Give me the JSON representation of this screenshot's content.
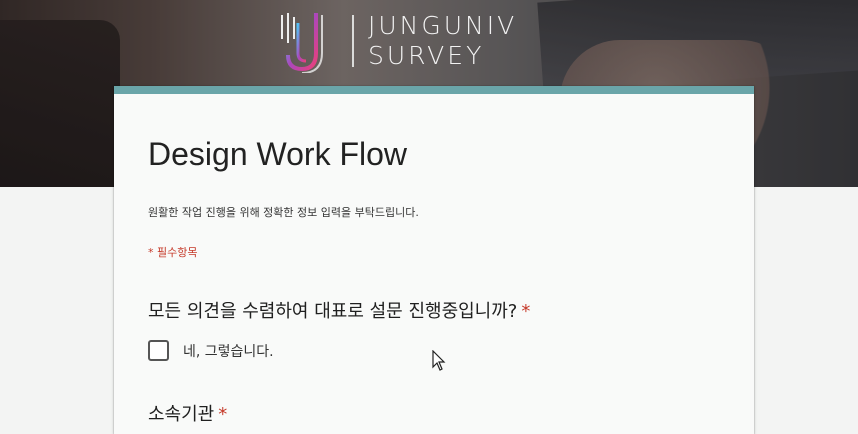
{
  "brand": {
    "line1": "JUNGUNIV",
    "line2": "SURVEY"
  },
  "colors": {
    "accent": "#6aa5a9",
    "required": "#c53929"
  },
  "form": {
    "title": "Design Work Flow",
    "description": "원활한 작업 진행을 위해 정확한 정보 입력을 부탁드립니다.",
    "required_note": "* 필수항목",
    "questions": [
      {
        "label": "모든 의견을 수렴하여 대표로 설문 진행중입니까?",
        "required_mark": "*",
        "options": [
          {
            "label": "네, 그렇습니다.",
            "checked": false
          }
        ]
      },
      {
        "label": "소속기관",
        "required_mark": "*"
      }
    ]
  }
}
